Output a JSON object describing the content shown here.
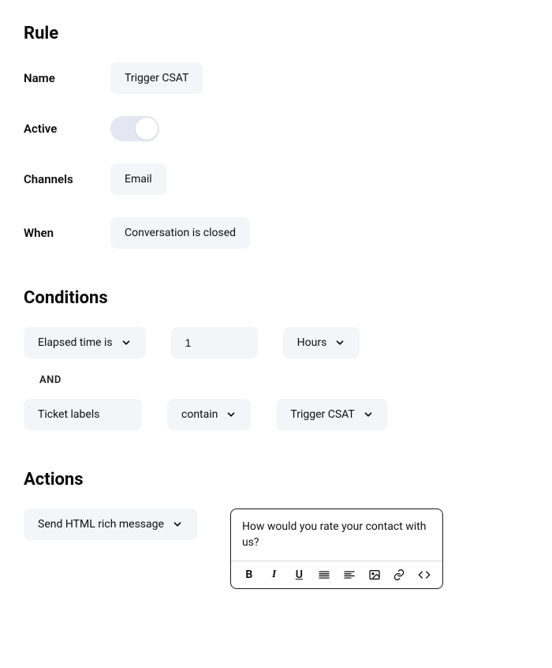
{
  "rule": {
    "heading": "Rule",
    "fields": {
      "name_label": "Name",
      "name_value": "Trigger CSAT",
      "active_label": "Active",
      "active_value": true,
      "channels_label": "Channels",
      "channels_value": "Email",
      "when_label": "When",
      "when_value": "Conversation is closed"
    }
  },
  "conditions": {
    "heading": "Conditions",
    "row1": {
      "field": "Elapsed time is",
      "value": "1",
      "unit": "Hours"
    },
    "connector": "AND",
    "row2": {
      "field": "Ticket labels",
      "operator": "contain",
      "value": "Trigger CSAT"
    }
  },
  "actions": {
    "heading": "Actions",
    "row1": {
      "type": "Send HTML rich message",
      "content": "How would you rate your contact with us?"
    }
  },
  "toolbar_labels": {
    "bold": "B",
    "italic": "I",
    "underline": "U"
  }
}
